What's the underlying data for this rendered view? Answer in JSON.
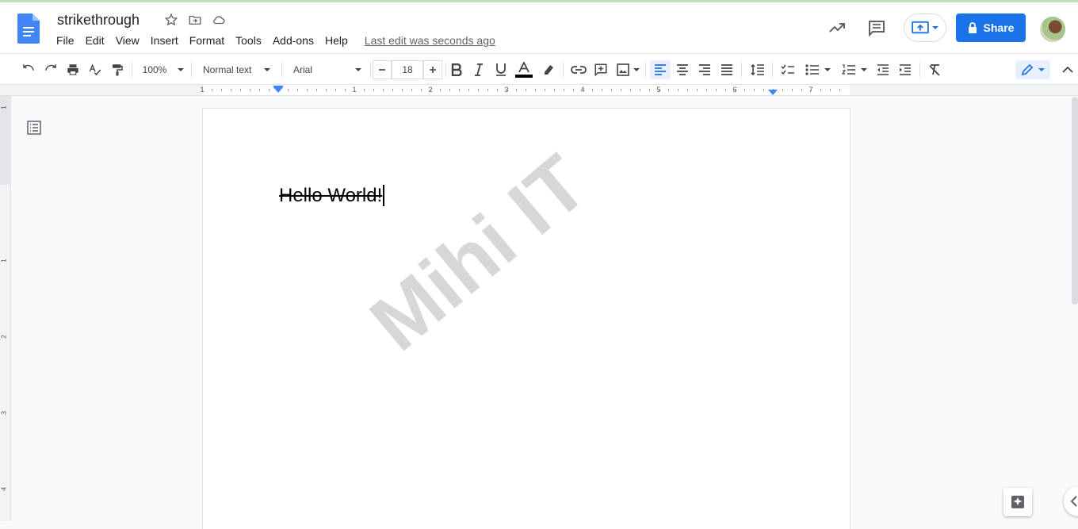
{
  "document": {
    "title": "strikethrough",
    "body_text": "Hello World!",
    "watermark": "Mihi IT"
  },
  "menu": {
    "items": [
      "File",
      "Edit",
      "View",
      "Insert",
      "Format",
      "Tools",
      "Add-ons",
      "Help"
    ],
    "last_edit": "Last edit was seconds ago"
  },
  "header": {
    "share_label": "Share"
  },
  "toolbar": {
    "zoom": "100%",
    "style": "Normal text",
    "font": "Arial",
    "font_size": "18"
  },
  "ruler": {
    "numbers": [
      "1",
      "1",
      "2",
      "3",
      "4",
      "5",
      "6",
      "7"
    ]
  },
  "vruler": {
    "numbers": [
      "1",
      "1",
      "2",
      "3",
      "4"
    ]
  },
  "colors": {
    "accent": "#1a73e8",
    "doc_blue": "#4285f4",
    "watermark": "#b8b8b8"
  }
}
